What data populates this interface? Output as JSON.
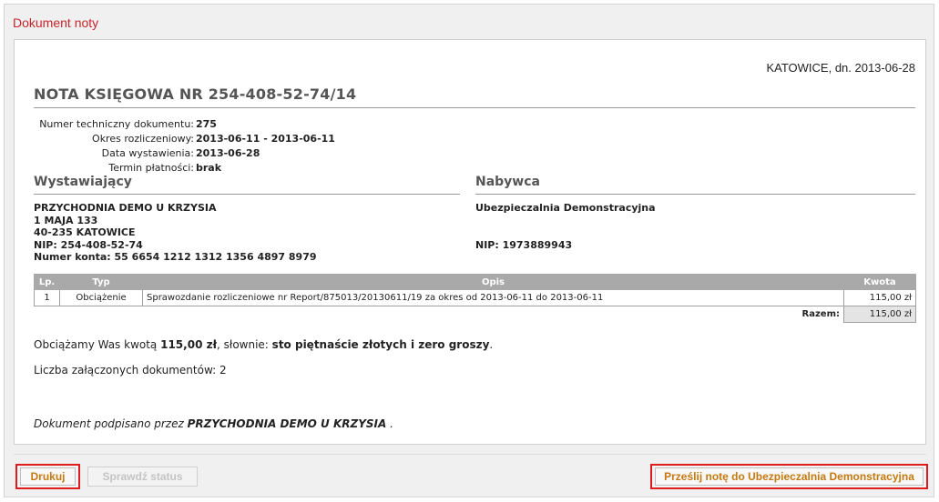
{
  "panel": {
    "title": "Dokument noty"
  },
  "document": {
    "city_date": "KATOWICE, dn. 2013-06-28",
    "title": "NOTA KSIĘGOWA NR 254-408-52-74/14",
    "meta": [
      {
        "label": "Numer techniczny dokumentu:",
        "value": "275"
      },
      {
        "label": "Okres rozliczeniowy:",
        "value": "2013-06-11 - 2013-06-11"
      },
      {
        "label": "Data wystawienia:",
        "value": "2013-06-28"
      },
      {
        "label": "Termin płatności:",
        "value": "brak"
      }
    ],
    "issuer": {
      "heading": "Wystawiający",
      "name": "PRZYCHODNIA DEMO U KRZYSIA",
      "street": "1 MAJA 133",
      "city": "40-235 KATOWICE",
      "nip": "NIP: 254-408-52-74",
      "account": "Numer konta: 55 6654 1212 1312 1356 4897 8979"
    },
    "buyer": {
      "heading": "Nabywca",
      "name": "Ubezpieczalnia Demonstracyjna",
      "nip": "NIP: 1973889943"
    },
    "table": {
      "headers": {
        "lp": "Lp.",
        "typ": "Typ",
        "opis": "Opis",
        "kwota": "Kwota"
      },
      "rows": [
        {
          "lp": "1",
          "typ": "Obciążenie",
          "opis": "Sprawozdanie rozliczeniowe nr Report/875013/20130611/19 za okres od 2013-06-11 do 2013-06-11",
          "kwota": "115,00 zł"
        }
      ],
      "total_label": "Razem:",
      "total_value": "115,00 zł"
    },
    "summary": {
      "prefix": "Obciążamy Was kwotą ",
      "amount": "115,00 zł",
      "middle": ", słownie: ",
      "words": "sto piętnaście złotych i zero groszy",
      "suffix": "."
    },
    "attachments": "Liczba załączonych dokumentów: 2",
    "signed": {
      "prefix": "Dokument podpisano przez ",
      "by": "PRZYCHODNIA DEMO U KRZYSIA",
      "suffix": " ."
    }
  },
  "buttons": {
    "print": "Drukuj",
    "check_status": "Sprawdź status",
    "send": "Prześlij notę do Ubezpieczalnia Demonstracyjna"
  },
  "colors": {
    "panel_title": "#c9252c",
    "highlight_border": "#e01b1b",
    "button_text": "#c47a10",
    "table_header": "#a9a9a9"
  }
}
